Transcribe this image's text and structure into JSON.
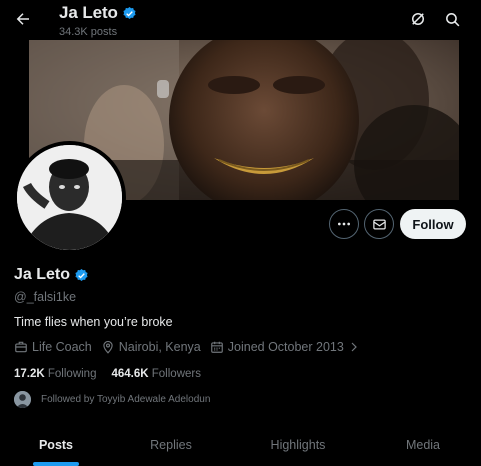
{
  "header": {
    "display_name": "Ja Leto",
    "posts_count": "34.3K posts"
  },
  "profile": {
    "display_name": "Ja Leto",
    "handle": "@_falsi1ke",
    "bio": "Time flies when you’re broke",
    "occupation": "Life Coach",
    "location": "Nairobi, Kenya",
    "joined": "Joined October 2013",
    "following_count": "17.2K",
    "following_label": "Following",
    "followers_count": "464.6K",
    "followers_label": "Followers",
    "followed_by": "Followed by Toyyib Adewale Adelodun"
  },
  "actions": {
    "follow_label": "Follow"
  },
  "tabs": [
    {
      "label": "Posts",
      "active": true
    },
    {
      "label": "Replies",
      "active": false
    },
    {
      "label": "Highlights",
      "active": false
    },
    {
      "label": "Media",
      "active": false
    }
  ],
  "colors": {
    "background": "#000000",
    "accent": "#1d9bf0",
    "text": "#e7e9ea",
    "muted": "#71767b",
    "follow_button_bg": "#eff3f4"
  },
  "icons": {
    "back": "arrow-left-icon",
    "grok": "grok-icon",
    "search": "search-icon",
    "more": "more-icon",
    "message": "message-icon",
    "verified": "verified-badge-icon",
    "occupation": "briefcase-icon",
    "location": "location-pin-icon",
    "joined": "calendar-icon",
    "joined_expand": "chevron-right-icon"
  }
}
